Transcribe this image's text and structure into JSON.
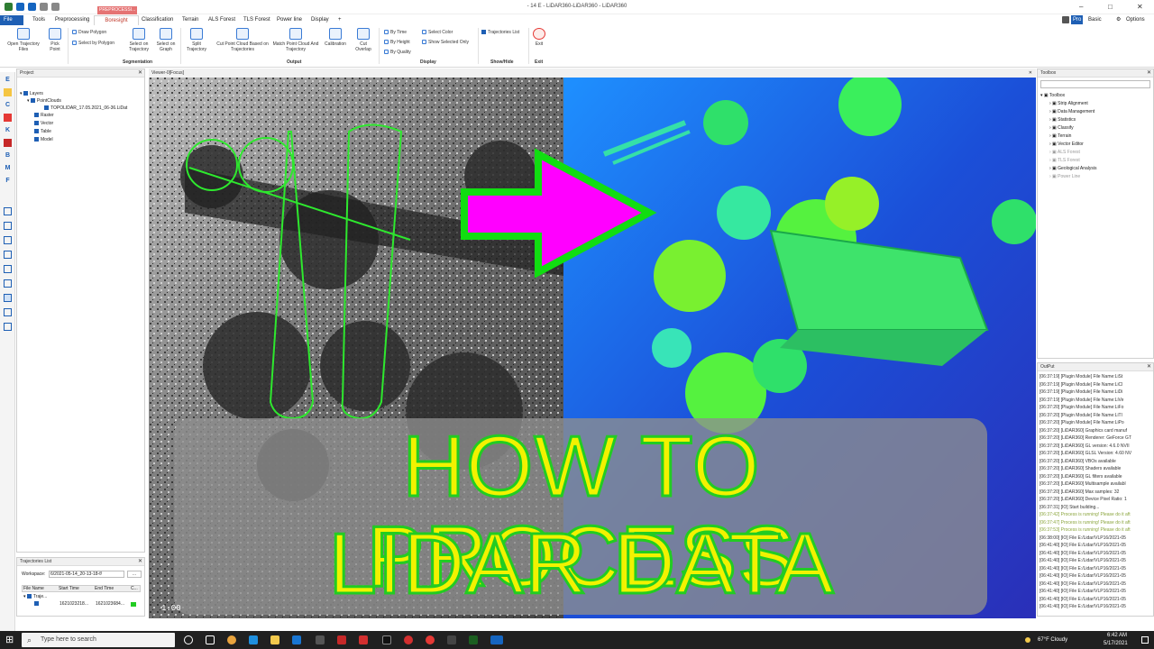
{
  "window": {
    "title": "- 14 E - LiDAR360-LiDAR360 - LiDAR360"
  },
  "tabs": {
    "file": "File",
    "tools": "Tools",
    "preprocessing": "Preprocessing",
    "boresight": "Boresight",
    "classification": "Classification",
    "terrain": "Terrain",
    "als_forest": "ALS Forest",
    "tls_forest": "TLS Forest",
    "power_line": "Power line",
    "display": "Display",
    "add": "+",
    "context_tag": "PREPROCESSI..."
  },
  "right_controls": {
    "pro": "Pro",
    "basic": "Basic",
    "options": "Options"
  },
  "ribbon": {
    "open_traj": "Open Trajectory Files",
    "pick_point": "Pick Point",
    "draw_polygon": "Draw Polygon",
    "select_polygon": "Select by Polygon",
    "select_on_traj": "Select on Trajectory",
    "select_on_graph": "Select on Graph",
    "split_traj": "Split Trajectory",
    "cut_point_cloud": "Cut Point Cloud Based on Trajectories",
    "match_point_cloud": "Match Point Cloud And Trajectory",
    "calibration": "Calibration",
    "cut_overlap": "Cut Overlap",
    "by_time": "By Time",
    "by_height": "By Height",
    "by_quality": "By Quality",
    "select_color": "Select Color",
    "show_selected_only": "Show Selected Only",
    "trajectories_list": "Trajectories List",
    "exit": "Exit",
    "group_segmentation": "Segmentation",
    "group_output": "Output",
    "group_display": "Display",
    "group_showhide": "Show/Hide",
    "group_exit": "Exit"
  },
  "vertical_toolbar": [
    "E",
    "C",
    "K",
    "B",
    "M",
    "F"
  ],
  "project": {
    "title": "Project",
    "items": [
      "Layers",
      "PointClouds",
      "TOPOLIDAR_17.05.2021_06-36.LiDat",
      "Raster",
      "Vector",
      "Table",
      "Model"
    ]
  },
  "traj_list": {
    "title": "Trajectories List",
    "workspace_label": "Workspace:",
    "workspace_value": "6/2021-05-14_20-13-18-f/",
    "browse": "...",
    "columns": [
      "File Name",
      "Start Time",
      "End Time",
      "C..."
    ],
    "group_row": "Traje...",
    "row": {
      "start": "1621023218...",
      "end": "1621023684..."
    }
  },
  "viewer": {
    "title": "Viewer-0[Focus]",
    "scale_label": "1.00"
  },
  "overlay": {
    "line1": "HOW TO PROCESS",
    "line2": "LIDAR DATA",
    "text_color": "#f2f200",
    "outline_color": "#22cc22",
    "arrow_color": "#ff00ff",
    "arrow_outline": "#11dd11"
  },
  "toolbox": {
    "title": "Toolbox",
    "root": "Toolbox",
    "items": [
      "Strip Alignment",
      "Data Management",
      "Statistics",
      "Classify",
      "Terrain",
      "Vector Editor",
      "ALS Forest",
      "TLS Forest",
      "Geological Analysis",
      "Power Line"
    ]
  },
  "output": {
    "title": "OutPut",
    "lines": [
      "[06:37:19] [Plugin Module]   File Name:LiSt",
      "[06:37:19] [Plugin Module]   File Name:LiCl",
      "[06:37:19] [Plugin Module]   File Name:LiDi",
      "[06:37:19] [Plugin Module]   File Name:LiVe",
      "[06:37:20] [Plugin Module]   File Name:LiFo",
      "[06:37:20] [Plugin Module]   File Name:LiTl",
      "[06:37:20] [Plugin Module]   File Name:LiPo",
      "[06:37:20] [LiDAR360]   Graphics card manuf",
      "[06:37:20] [LiDAR360]   Renderer: GeForce GT",
      "[06:37:20] [LiDAR360]   GL version: 4.6.0 NVII",
      "[06:37:20] [LiDAR360]   GLSL Version: 4.60 NV",
      "[06:37:20] [LiDAR360]   VBOs available",
      "[06:37:20] [LiDAR360]   Shaders available",
      "[06:37:20] [LiDAR360]   GL filters available",
      "[06:37:20] [LiDAR360]   Multisample availabl",
      "[06:37:20] [LiDAR360]   Max samples: 32",
      "[06:37:20] [LiDAR360]   Device Pixel Ratio: 1",
      "[06:37:31] [IO]   Start building...",
      "[06:37:42] Process is running! Please do it aft",
      "[06:37:47] Process is running! Please do it aft",
      "[06:37:53] Process is running! Please do it aft",
      "[06:38:00] [IO]   File E:/Lidar/VLP16/2021-05",
      "[06:41:40] [IO]   File E:/Lidar/VLP16/2021-05",
      "[06:41:40] [IO]   File E:/Lidar/VLP16/2021-05",
      "[06:41:40] [IO]   File E:/Lidar/VLP16/2021-05",
      "[06:41:40] [IO]   File E:/Lidar/VLP16/2021-05",
      "[06:41:40] [IO]   File E:/Lidar/VLP16/2021-05",
      "[06:41:40] [IO]   File E:/Lidar/VLP16/2021-05",
      "[06:41:40] [IO]   File E:/Lidar/VLP16/2021-05",
      "[06:41:40] [IO]   File E:/Lidar/VLP16/2021-05",
      "[06:41:40] [IO]   File E:/Lidar/VLP16/2021-05"
    ]
  },
  "taskbar": {
    "search_placeholder": "Type here to search",
    "weather": "67°F  Cloudy",
    "time": "6:42 AM",
    "date": "5/17/2021"
  }
}
